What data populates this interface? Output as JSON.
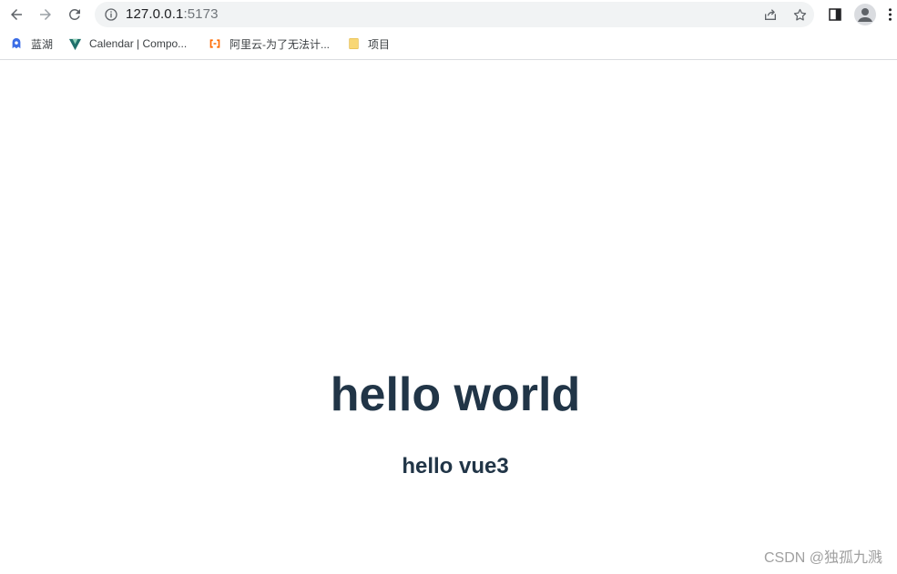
{
  "browser": {
    "url_host": "127.0.0.1",
    "url_port": ":5173",
    "icons": {
      "back": "arrow-left-icon",
      "forward": "arrow-right-icon",
      "reload": "reload-icon",
      "info": "info-icon",
      "share": "share-icon",
      "bookmark": "star-icon",
      "side_panel": "side-panel-icon",
      "profile": "avatar-icon",
      "menu": "kebab-menu-icon"
    }
  },
  "bookmarks": [
    {
      "label": "蓝湖",
      "icon": "lanhu-icon",
      "color": "#3b6de6"
    },
    {
      "label": "Calendar | Compo...",
      "icon": "vuetify-icon",
      "color": "#1f6f6b"
    },
    {
      "label": "阿里云-为了无法计...",
      "icon": "aliyun-icon",
      "color": "#ff6a00"
    },
    {
      "label": "项目",
      "icon": "folder-icon",
      "color": "#f8d775"
    }
  ],
  "page": {
    "heading": "hello world",
    "subheading": "hello vue3",
    "text_color": "#213547"
  },
  "watermark": "CSDN @独孤九溅"
}
